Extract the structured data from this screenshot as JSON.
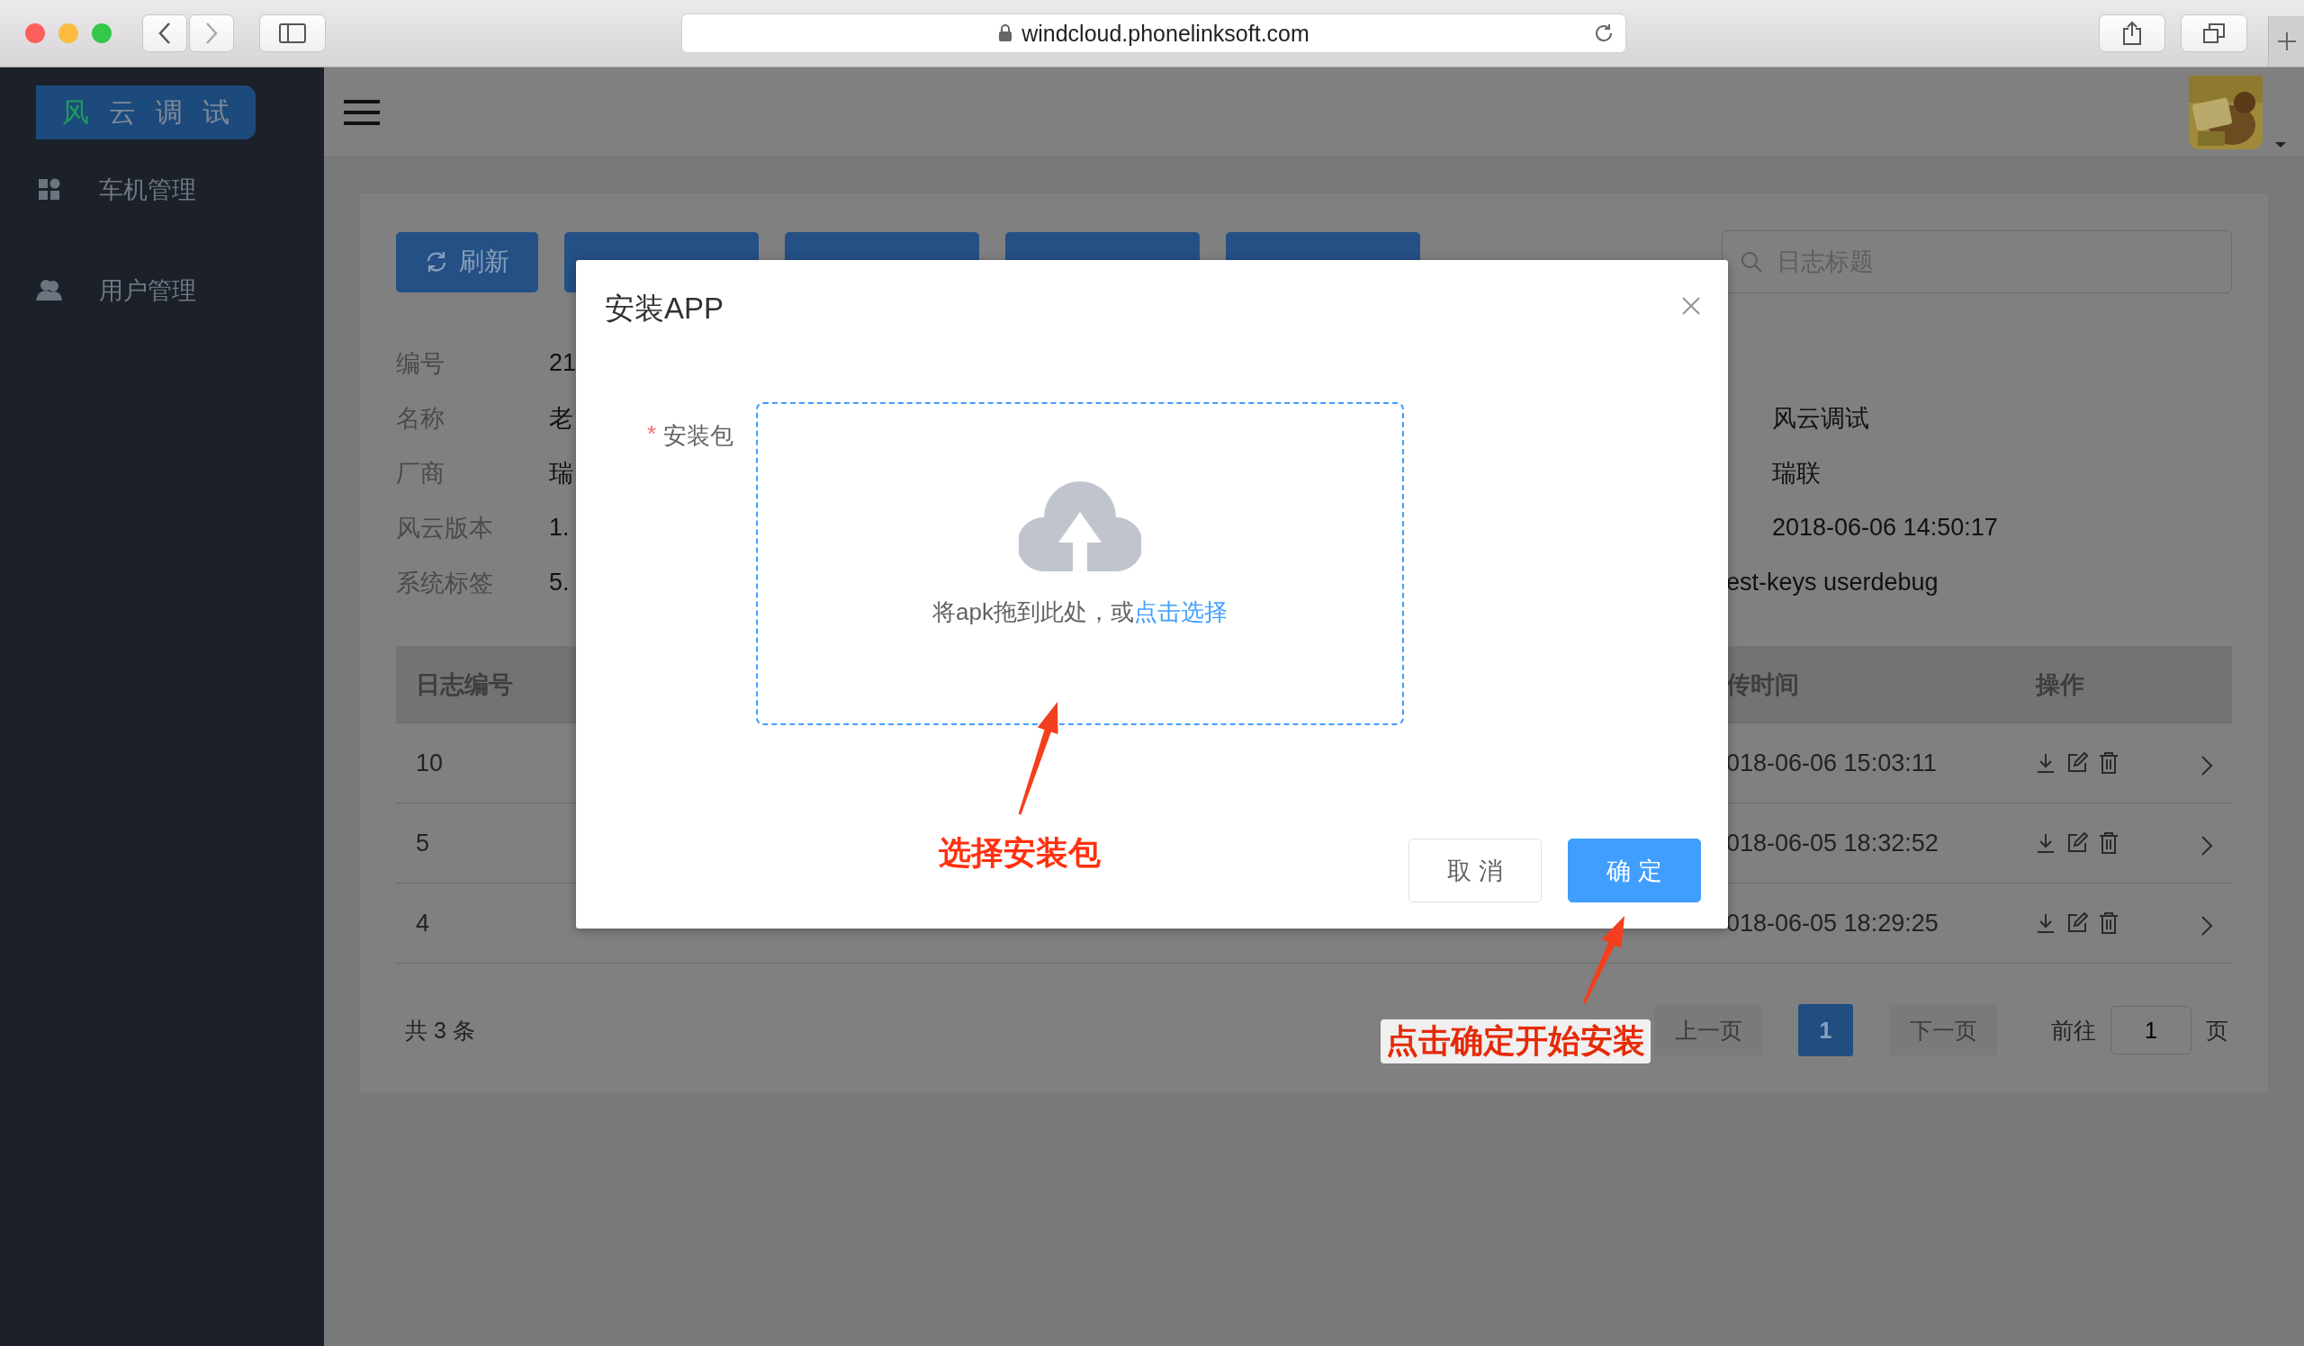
{
  "browser": {
    "url": "windcloud.phonelinksoft.com"
  },
  "sidebar": {
    "logo": [
      {
        "text": "风",
        "color": "#1f9c5a"
      },
      {
        "text": "云",
        "color": "#7f8a98"
      },
      {
        "text": "调",
        "color": "#7f8a98"
      },
      {
        "text": "试",
        "color": "#7f8a98"
      }
    ],
    "menu": [
      {
        "label": "车机管理",
        "kind": "grid"
      },
      {
        "label": "用户管理",
        "kind": "users"
      }
    ]
  },
  "toolbar": {
    "buttons": [
      {
        "kind": "labeled",
        "label": "刷新"
      },
      {
        "kind": "covered"
      },
      {
        "kind": "covered"
      },
      {
        "kind": "covered"
      },
      {
        "kind": "covered"
      }
    ],
    "search": {
      "placeholder": "日志标题"
    }
  },
  "details": [
    {
      "label": "编号",
      "value": "21"
    },
    {
      "label": "名称",
      "value": "老",
      "value_right": "风云调试"
    },
    {
      "label": "厂商",
      "value": "瑞",
      "value_right": "瑞联"
    },
    {
      "label": "风云版本",
      "value": "1.",
      "value_right": "2018-06-06 14:50:17"
    },
    {
      "label": "系统标签",
      "value": "5.",
      "value_tail": "est-keys userdebug"
    }
  ],
  "table": {
    "columns": [
      "日志编号",
      "传时间",
      "操作"
    ],
    "rows": [
      {
        "id": "10",
        "time": "018-06-06 15:03:11"
      },
      {
        "id": "5",
        "time": "018-06-05 18:32:52"
      },
      {
        "id": "4",
        "time": "018-06-05 18:29:25"
      }
    ]
  },
  "footer": {
    "total": "共 3 条",
    "prev": "上一页",
    "pages": [
      {
        "label": "1",
        "selected": true
      }
    ],
    "next": "下一页",
    "goto": "前往",
    "goto_value": "1",
    "page_unit": "页"
  },
  "dialog": {
    "title": "安装APP",
    "field": {
      "required_mark": "*",
      "label": "安装包"
    },
    "upload": {
      "text": "将apk拖到此处，或",
      "link": "点击选择"
    },
    "buttons": [
      {
        "label": "取 消",
        "kind": "default"
      },
      {
        "label": "确 定",
        "kind": "primary"
      }
    ]
  },
  "annotations": [
    {
      "text": "选择安装包"
    },
    {
      "text": "点击确定开始安装"
    }
  ]
}
